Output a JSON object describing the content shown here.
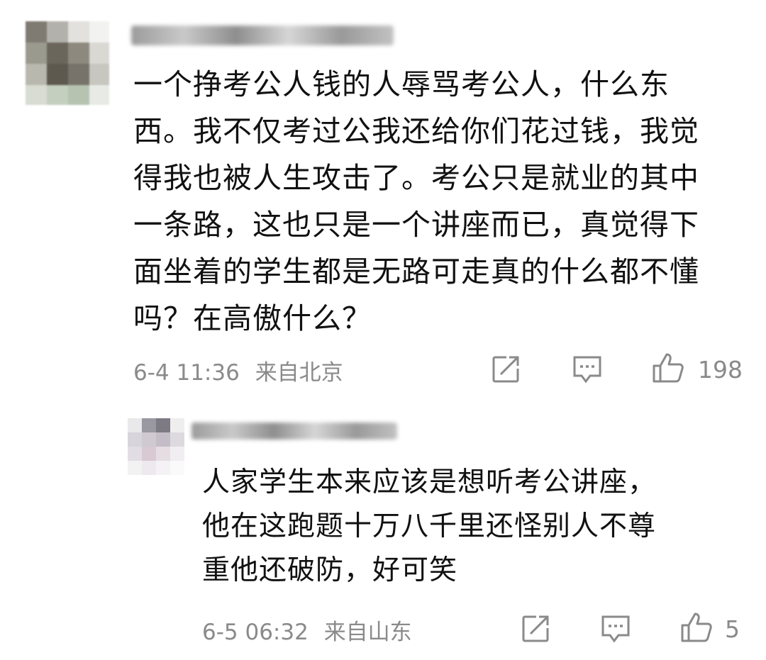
{
  "comment": {
    "text": "一个挣考公人钱的人辱骂考公人，什么东\n西。我不仅考过公我还给你们花过钱，我觉\n得我也被人生攻击了。考公只是就业的其中\n一条路，这也只是一个讲座而已，真觉得下\n面坐着的学生都是无路可走真的什么都不懂\n吗？在高傲什么？",
    "timestamp": "6-4 11:36",
    "location": "来自北京",
    "likes": "198"
  },
  "reply": {
    "text": "人家学生本来应该是想听考公讲座，\n他在这跑题十万八千里还怪别人不尊\n重他还破防，好可笑",
    "timestamp": "6-5 06:32",
    "location": "来自山东",
    "likes": "5"
  },
  "icons": [
    "share-icon",
    "comment-icon",
    "thumbs-up-icon"
  ],
  "colors": {
    "text": "#111111",
    "meta": "#8a8a8a",
    "icon": "#8a8a8a"
  }
}
